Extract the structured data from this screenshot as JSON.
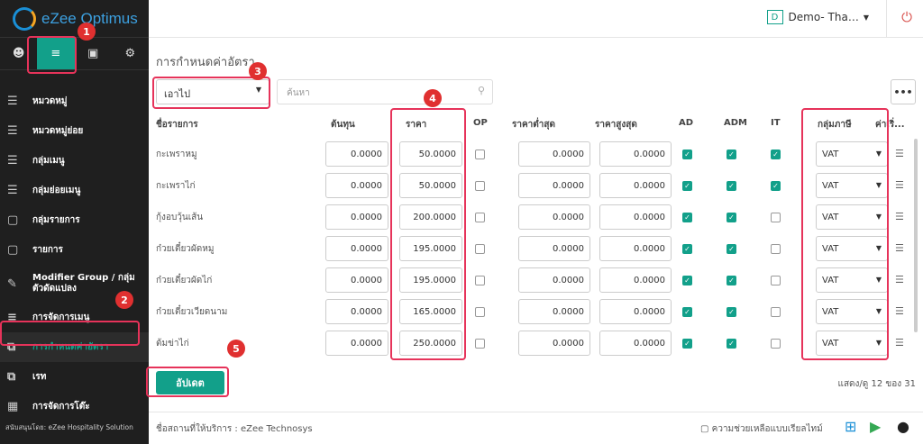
{
  "app": {
    "logo_text": "eZee Optimus",
    "brand_color": "#12a08a",
    "highlight_color": "#e6335a"
  },
  "header": {
    "property_badge": "D",
    "property_name": "Demo- Tha…",
    "power_icon": "power-icon"
  },
  "sidebar": {
    "tools": [
      "user-icon",
      "menu-icon",
      "cart-icon",
      "gear-icon"
    ],
    "items": [
      {
        "label": "หมวดหมู่",
        "icon": "list-icon"
      },
      {
        "label": "หมวดหมู่ย่อย",
        "icon": "sublist-icon"
      },
      {
        "label": "กลุ่มเมนู",
        "icon": "list-icon"
      },
      {
        "label": "กลุ่มย่อยเมนู",
        "icon": "sublist-icon"
      },
      {
        "label": "กลุ่มรายการ",
        "icon": "box-icon"
      },
      {
        "label": "รายการ",
        "icon": "box-icon"
      },
      {
        "label": "Modifier Group / กลุ่มตัวดัดแปลง",
        "icon": "edit-icon"
      },
      {
        "label": "การจัดการเมนู",
        "icon": "menu-icon"
      },
      {
        "label": "การกำหนดค่าอัตรา",
        "icon": "copy-icon"
      },
      {
        "label": "เรท",
        "icon": "copy-icon"
      },
      {
        "label": "การจัดการโต๊ะ",
        "icon": "grid-icon"
      }
    ],
    "footer": "สนับสนุนโดย: eZee Hospitality Solution"
  },
  "main": {
    "title": "การกำหนดค่าอัตรา",
    "order_type": "เอาไป",
    "search_placeholder": "ค้นหา",
    "more_label": "•••",
    "columns": {
      "name": "ชื่อรายการ",
      "cost": "ต้นทุน",
      "price": "ราคา",
      "op": "OP",
      "min_price": "ราคาต่ำสุด",
      "max_price": "ราคาสูงสุด",
      "ad": "AD",
      "adm": "ADM",
      "it": "IT",
      "tax_group": "กลุ่มภาษี",
      "more": "ค่าเริ่..."
    },
    "rows": [
      {
        "name": "กะเพราหมู",
        "cost": "0.0000",
        "price": "50.0000",
        "op": false,
        "min": "0.0000",
        "max": "0.0000",
        "ad": true,
        "adm": true,
        "it": true,
        "tax": "VAT"
      },
      {
        "name": "กะเพราไก่",
        "cost": "0.0000",
        "price": "50.0000",
        "op": false,
        "min": "0.0000",
        "max": "0.0000",
        "ad": true,
        "adm": true,
        "it": true,
        "tax": "VAT"
      },
      {
        "name": "กุ้งอบวุ้นเส้น",
        "cost": "0.0000",
        "price": "200.0000",
        "op": false,
        "min": "0.0000",
        "max": "0.0000",
        "ad": true,
        "adm": true,
        "it": false,
        "tax": "VAT"
      },
      {
        "name": "ก๋วยเตี๋ยวผัดหมู",
        "cost": "0.0000",
        "price": "195.0000",
        "op": false,
        "min": "0.0000",
        "max": "0.0000",
        "ad": true,
        "adm": true,
        "it": false,
        "tax": "VAT"
      },
      {
        "name": "ก๋วยเตี๋ยวผัดไก่",
        "cost": "0.0000",
        "price": "195.0000",
        "op": false,
        "min": "0.0000",
        "max": "0.0000",
        "ad": true,
        "adm": true,
        "it": false,
        "tax": "VAT"
      },
      {
        "name": "ก๋วยเตี๋ยวเวียดนาม",
        "cost": "0.0000",
        "price": "165.0000",
        "op": false,
        "min": "0.0000",
        "max": "0.0000",
        "ad": true,
        "adm": true,
        "it": false,
        "tax": "VAT"
      },
      {
        "name": "ต้มข่าไก่",
        "cost": "0.0000",
        "price": "250.0000",
        "op": false,
        "min": "0.0000",
        "max": "0.0000",
        "ad": true,
        "adm": true,
        "it": false,
        "tax": "VAT"
      }
    ],
    "update_label": "อัปเดต",
    "paging": "แสดง/ดู 12 ของ 31"
  },
  "footer": {
    "provider": "ชื่อสถานที่ให้บริการ : eZee Technosys",
    "help": "ความช่วยเหลือแบบเรียลไทม์",
    "stores": [
      "windows-icon",
      "play-store-icon",
      "apple-icon"
    ]
  },
  "annotations": [
    "1",
    "2",
    "3",
    "4",
    "5"
  ]
}
